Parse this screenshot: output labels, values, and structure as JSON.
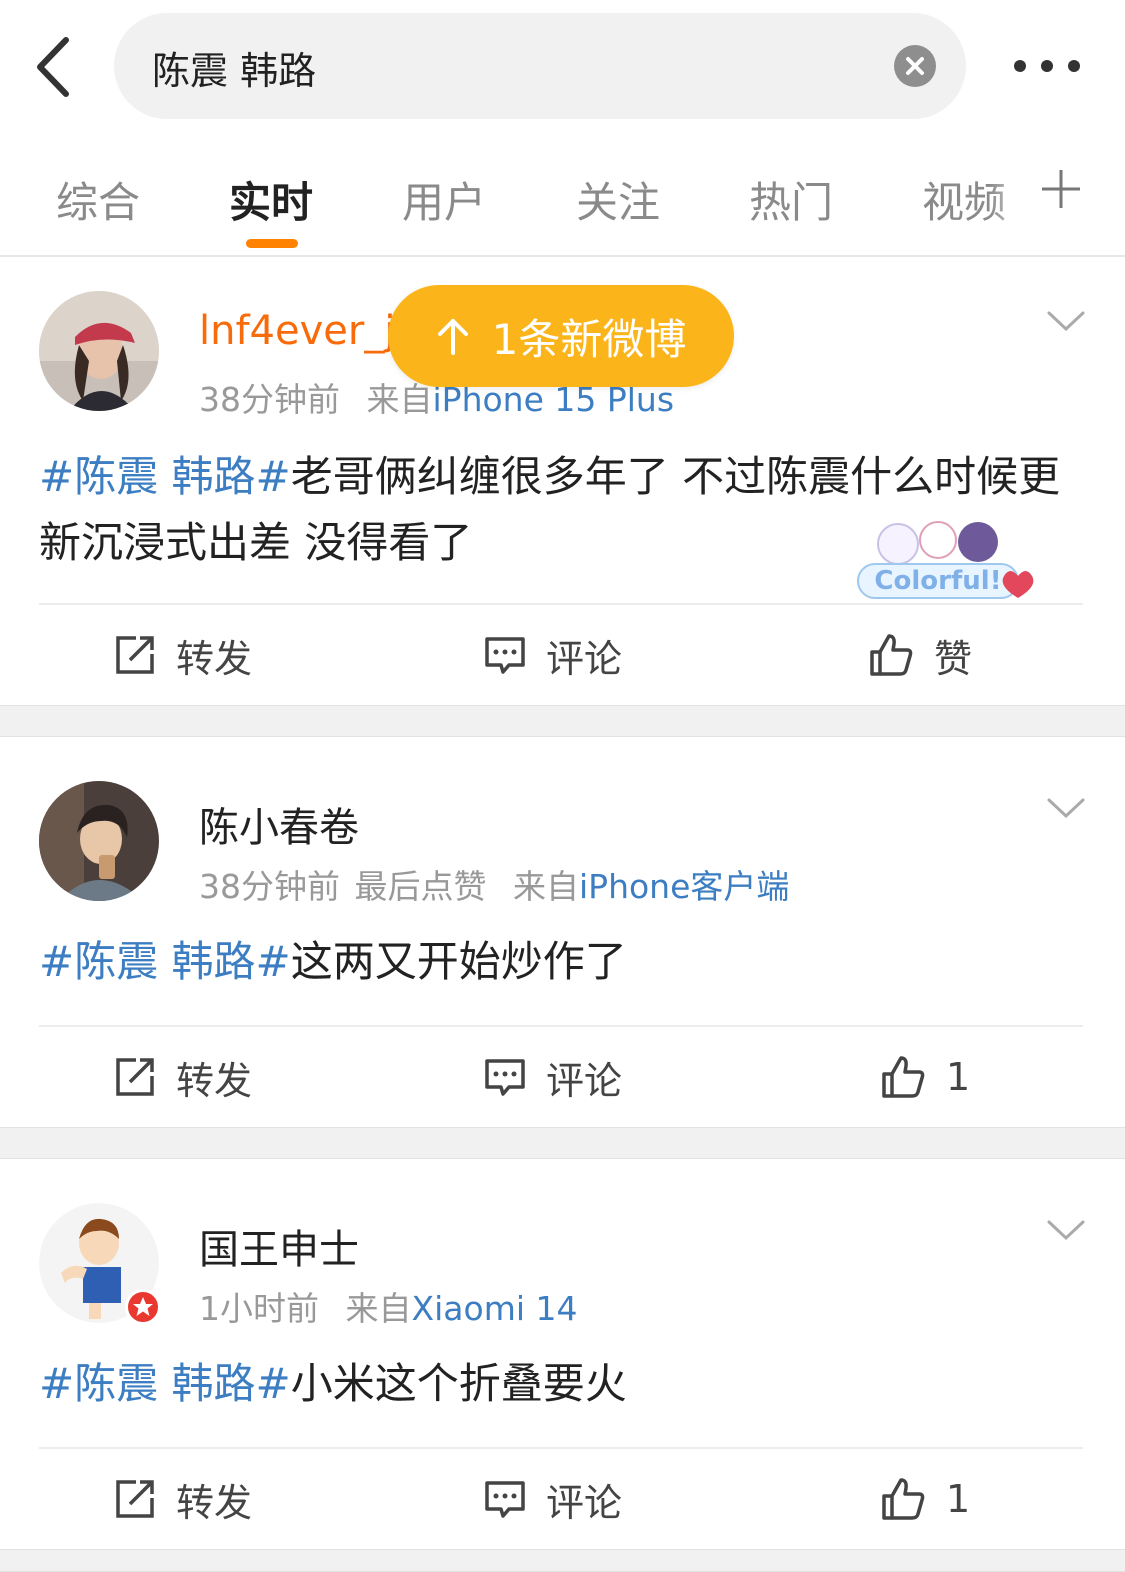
{
  "search": {
    "query": "陈震 韩路"
  },
  "tabs": [
    "综合",
    "实时",
    "用户",
    "关注",
    "热门",
    "视频"
  ],
  "new_posts_pill": "1条新微博",
  "posts": [
    {
      "username": "lnf4ever_j",
      "time": "38分钟前",
      "extra": "",
      "source_prefix": "来自",
      "source": "iPhone 15 Plus",
      "topic": "#陈震 韩路#",
      "text": "老哥俩纠缠很多年了 不过陈震什么时候更新沉浸式出差 没得看了",
      "badge_text": "Colorful!",
      "repost_label": "转发",
      "comment_label": "评论",
      "like_label": "赞"
    },
    {
      "username": "陈小春卷",
      "time": "38分钟前",
      "extra": "最后点赞",
      "source_prefix": "来自",
      "source": "iPhone客户端",
      "topic": "#陈震 韩路#",
      "text": "这两又开始炒作了",
      "repost_label": "转发",
      "comment_label": "评论",
      "like_label": "1"
    },
    {
      "username": "国王申士",
      "time": "1小时前",
      "extra": "",
      "source_prefix": "来自",
      "source": "Xiaomi 14",
      "topic": "#陈震 韩路#",
      "text": "小米这个折叠要火",
      "repost_label": "转发",
      "comment_label": "评论",
      "like_label": "1"
    }
  ],
  "colors": {
    "accent": "#ff8200",
    "link": "#3d7ec2",
    "pill": "#fbb51a",
    "username_vip": "#f86b0a"
  }
}
